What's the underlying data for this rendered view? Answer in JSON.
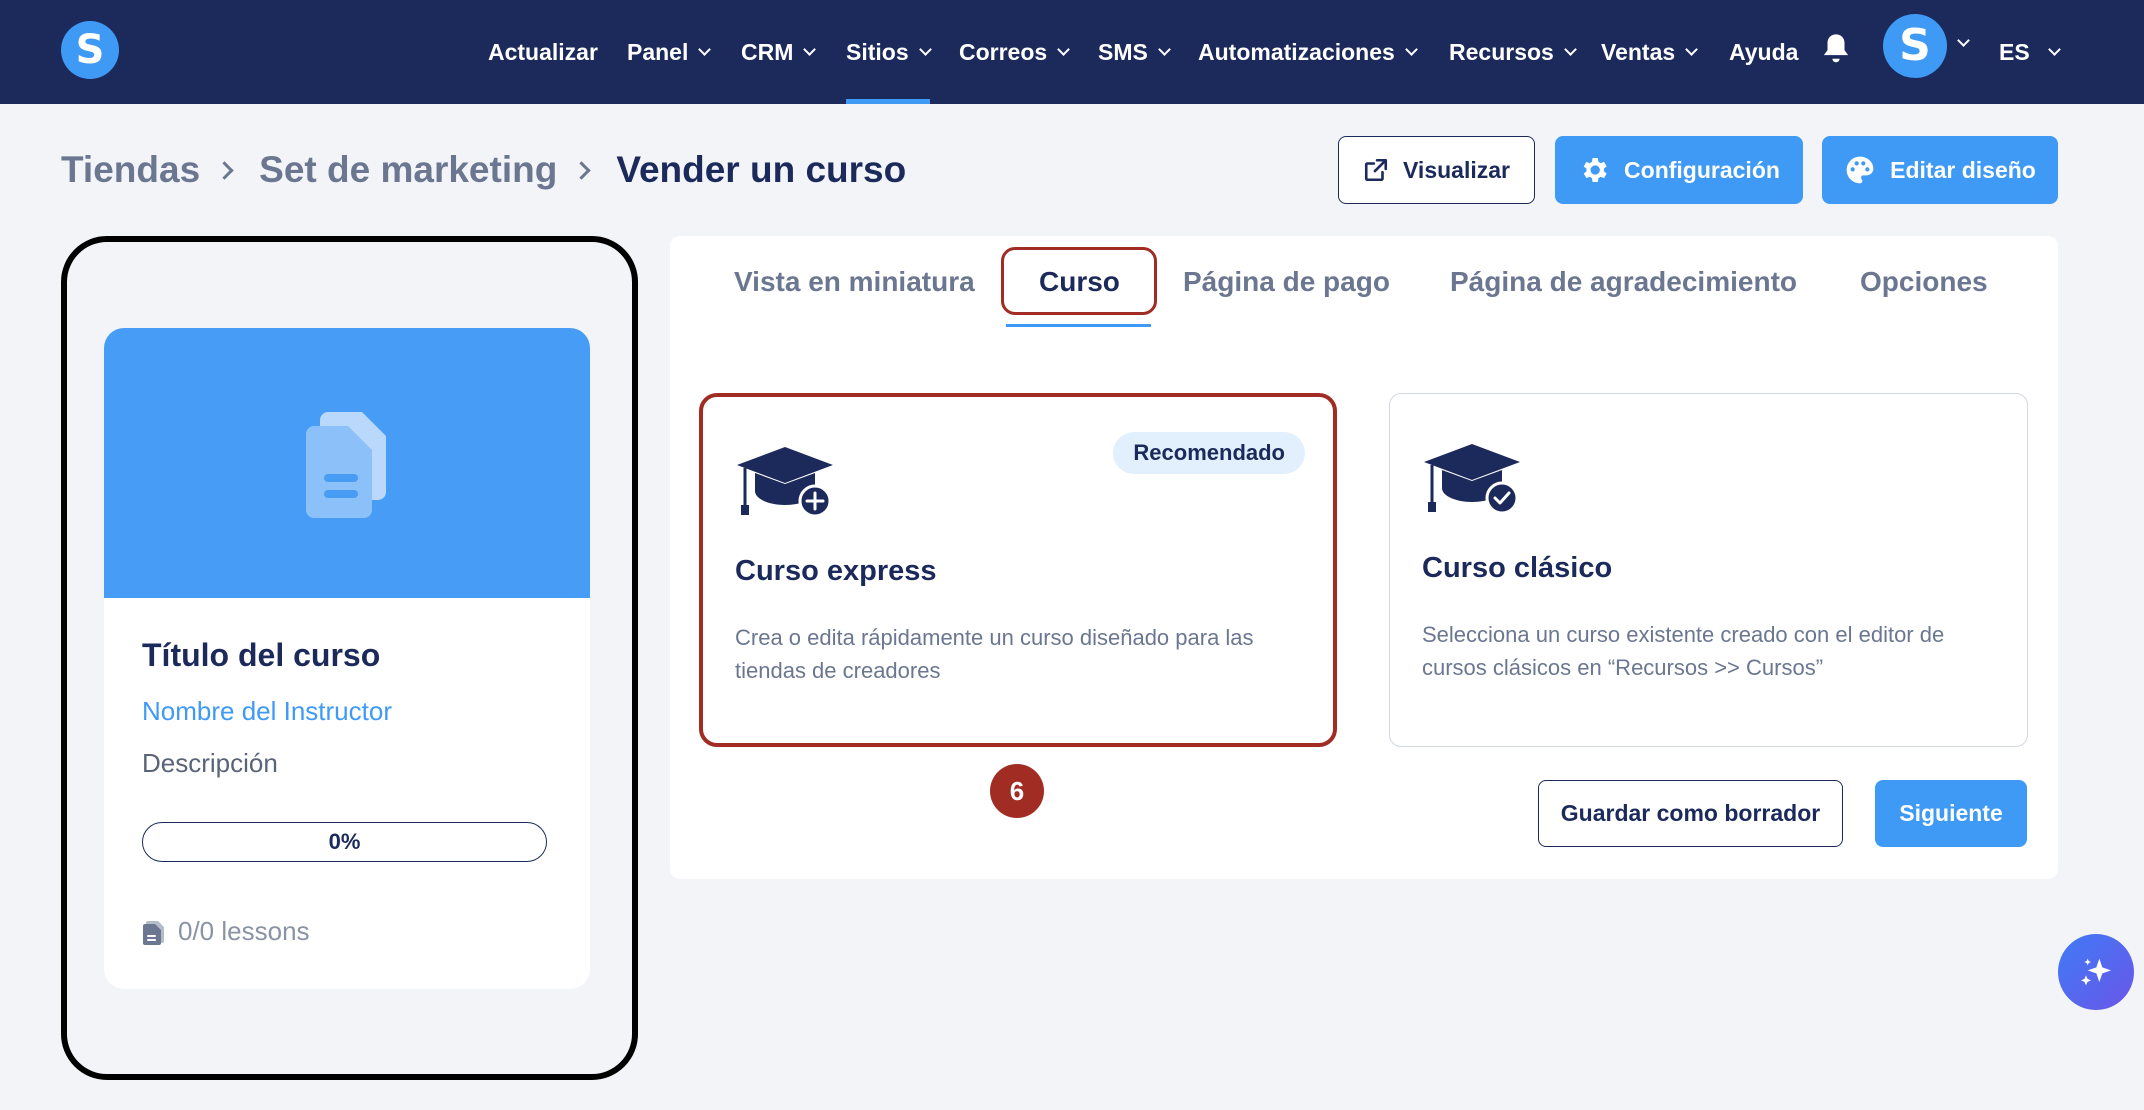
{
  "nav": {
    "logo": "S",
    "items": [
      {
        "label": "Actualizar",
        "chevron": false
      },
      {
        "label": "Panel",
        "chevron": true
      },
      {
        "label": "CRM",
        "chevron": true
      },
      {
        "label": "Sitios",
        "chevron": true,
        "active": true
      },
      {
        "label": "Correos",
        "chevron": true
      },
      {
        "label": "SMS",
        "chevron": true
      },
      {
        "label": "Automatizaciones",
        "chevron": true
      },
      {
        "label": "Recursos",
        "chevron": true
      },
      {
        "label": "Ventas",
        "chevron": true
      },
      {
        "label": "Ayuda",
        "chevron": false
      }
    ],
    "avatar": "S",
    "language": "ES"
  },
  "breadcrumb": {
    "items": [
      "Tiendas",
      "Set de marketing"
    ],
    "current": "Vender un curso"
  },
  "header_buttons": {
    "preview": "Visualizar",
    "settings": "Configuración",
    "edit_design": "Editar diseño"
  },
  "preview_card": {
    "title": "Título del curso",
    "instructor": "Nombre del Instructor",
    "description": "Descripción",
    "progress": "0%",
    "progress_value": 0,
    "lessons": "0/0 lessons"
  },
  "tabs": [
    {
      "label": "Vista en miniatura"
    },
    {
      "label": "Curso",
      "active": true
    },
    {
      "label": "Página de pago"
    },
    {
      "label": "Página de agradecimiento"
    },
    {
      "label": "Opciones"
    }
  ],
  "options": [
    {
      "title": "Curso express",
      "badge": "Recomendado",
      "description": "Crea o edita rápidamente un curso diseñado para las tiendas de creadores",
      "icon": "graduation-cap-plus-icon",
      "selected": true
    },
    {
      "title": "Curso clásico",
      "description": "Selecciona un curso existente creado con el editor de cursos clásicos en “Recursos >> Cursos”",
      "icon": "graduation-cap-check-icon",
      "selected": false
    }
  ],
  "step_marker": "6",
  "footer_buttons": {
    "save_draft": "Guardar como borrador",
    "next": "Siguiente"
  },
  "colors": {
    "navbar": "#1b2a5b",
    "accent": "#3f9af5",
    "highlight": "#a12c24"
  }
}
